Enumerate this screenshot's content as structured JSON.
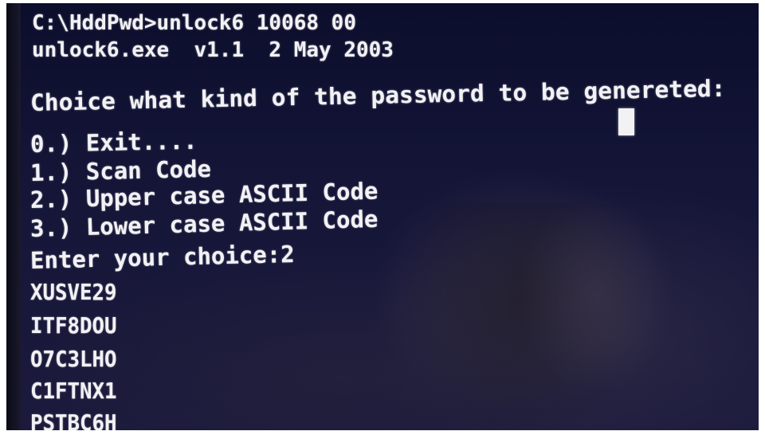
{
  "terminal": {
    "command_line": "C:\\HddPwd>unlock6 10068 00",
    "version_line": "unlock6.exe  v1.1  2 May 2003",
    "prompt": "Choice what kind of the password to be genereted:",
    "options": [
      "0.) Exit....",
      "1.) Scan Code",
      "2.) Upper case ASCII Code",
      "3.) Lower case ASCII Code"
    ],
    "enter_choice": "Enter your choice:2",
    "passwords": [
      "XUSVE29",
      "ITF8DOU",
      "O7C3LHO",
      "C1FTNX1",
      "PSTBC6H"
    ]
  },
  "colors": {
    "screen_background": "#131436",
    "text": "#f2f2f5"
  },
  "icons": {
    "cursor": "block-cursor-icon"
  }
}
